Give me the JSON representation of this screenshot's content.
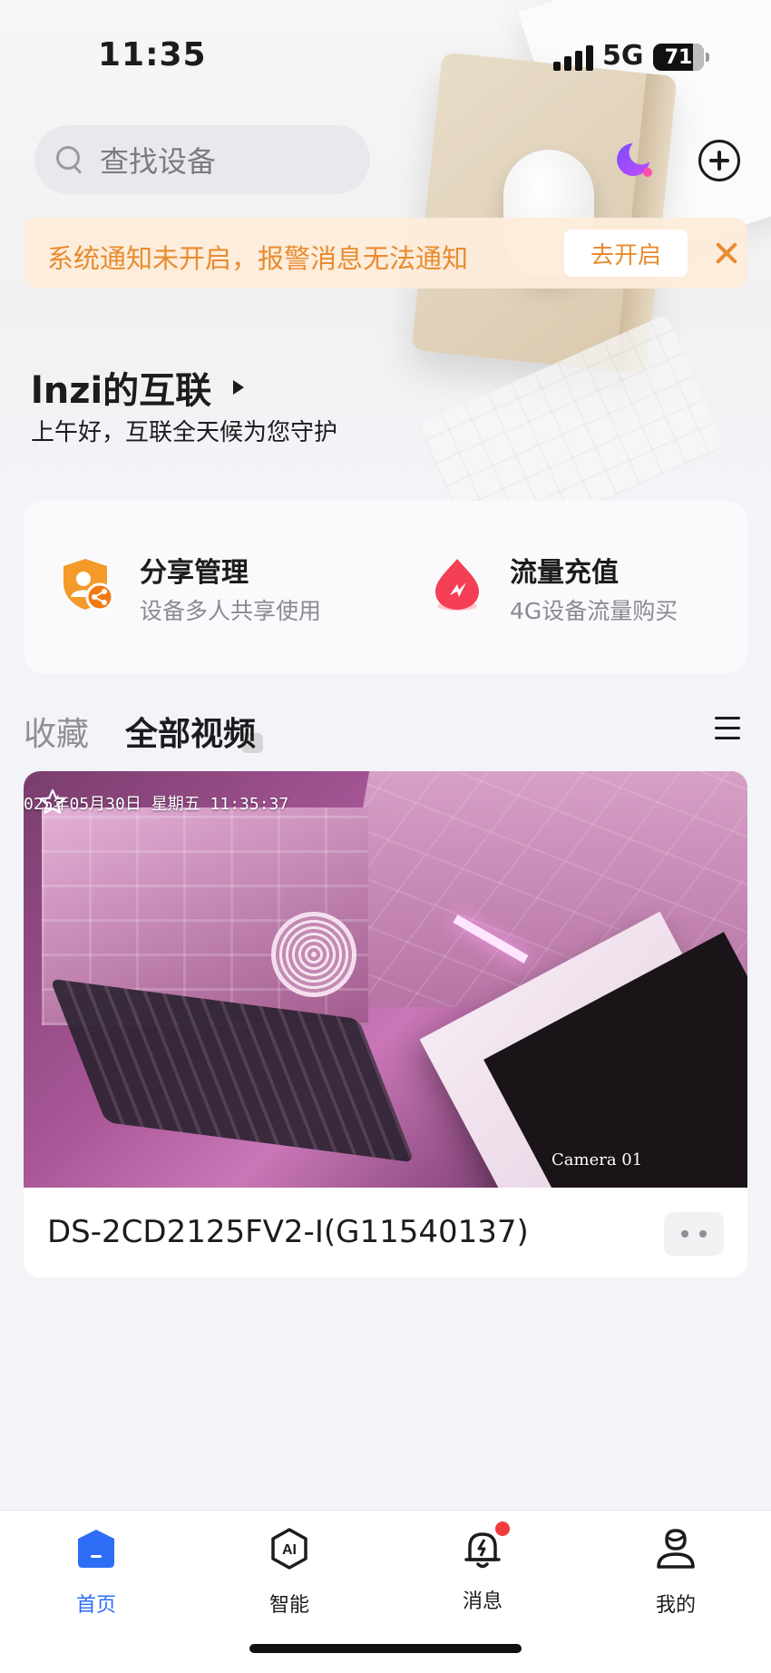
{
  "status_bar": {
    "time": "11:35",
    "network": "5G",
    "battery": "71"
  },
  "search": {
    "placeholder": "查找设备"
  },
  "notice": {
    "message": "系统通知未开启，报警消息无法通知",
    "action": "去开启"
  },
  "home": {
    "title": "lnzi的互联",
    "greeting": "上午好，互联全天候为您守护"
  },
  "quick_actions": [
    {
      "title": "分享管理",
      "subtitle": "设备多人共享使用",
      "icon": "share-manage-icon"
    },
    {
      "title": "流量充值",
      "subtitle": "4G设备流量购买",
      "icon": "data-recharge-icon"
    }
  ],
  "tabs": {
    "favorites": "收藏",
    "all_videos": "全部视频"
  },
  "camera": {
    "osd_date": "025年05月30日  星期五  11:35:37",
    "osd_name": "Camera 01",
    "device_name": "DS-2CD2125FV2-I(G11540137)"
  },
  "tabbar": [
    {
      "label": "首页",
      "icon": "home-icon",
      "active": true
    },
    {
      "label": "智能",
      "icon": "ai-icon",
      "active": false
    },
    {
      "label": "消息",
      "icon": "bell-icon",
      "active": false,
      "badge": true
    },
    {
      "label": "我的",
      "icon": "profile-icon",
      "active": false
    }
  ],
  "colors": {
    "accent": "#2e6df6",
    "notice_text": "#e98b2f",
    "notice_bg": "#fdecda",
    "badge": "#f23b3b"
  }
}
